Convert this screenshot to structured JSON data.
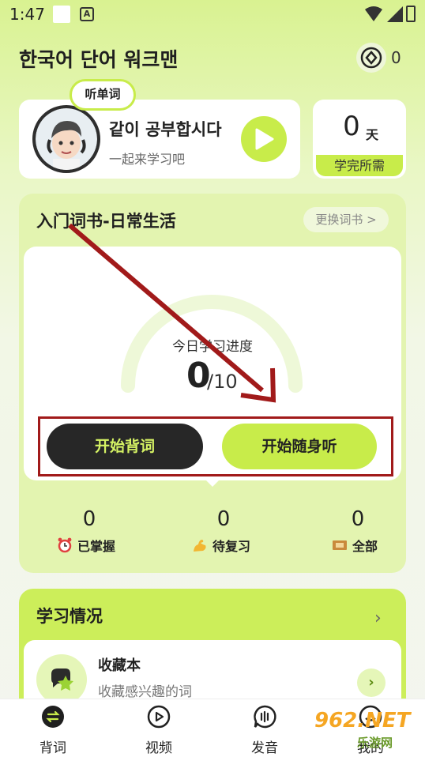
{
  "status_bar": {
    "time": "1:47",
    "notif_icon": "A"
  },
  "header": {
    "title": "한국어 단어 워크맨",
    "coin_count": "0"
  },
  "profile": {
    "bubble": "听单词",
    "title": "같이 공부합시다",
    "subtitle": "一起来学习吧"
  },
  "days": {
    "value": "0",
    "unit": "天",
    "label": "学完所需"
  },
  "wordbook": {
    "title": "入门词书-日常生活",
    "change_label": "更换词书 >",
    "progress_label": "今日学习进度",
    "progress_value": "0",
    "progress_total": "/10",
    "progress_fraction": 0,
    "start_button": "开始背词",
    "listen_button": "开始随身听",
    "stats": [
      {
        "value": "0",
        "label": "已掌握",
        "icon": "alarm-clock-icon"
      },
      {
        "value": "0",
        "label": "待复习",
        "icon": "flexed-arm-icon"
      },
      {
        "value": "0",
        "label": "全部",
        "icon": "ticket-icon"
      }
    ]
  },
  "study": {
    "title": "学习情况",
    "favorites_title": "收藏本",
    "favorites_sub": "收藏感兴趣的词"
  },
  "nav": [
    {
      "label": "背词",
      "icon": "swap-icon",
      "active": true
    },
    {
      "label": "视频",
      "icon": "video-play-icon",
      "active": false
    },
    {
      "label": "发音",
      "icon": "speech-bubble-icon",
      "active": false
    },
    {
      "label": "我的",
      "icon": "profile-icon",
      "active": false
    }
  ],
  "watermark": {
    "brand": "962.NET",
    "sub": "乐游网"
  },
  "colors": {
    "accent": "#c8ec4a",
    "dark_button": "#272727",
    "annotation": "#a11a1a"
  }
}
